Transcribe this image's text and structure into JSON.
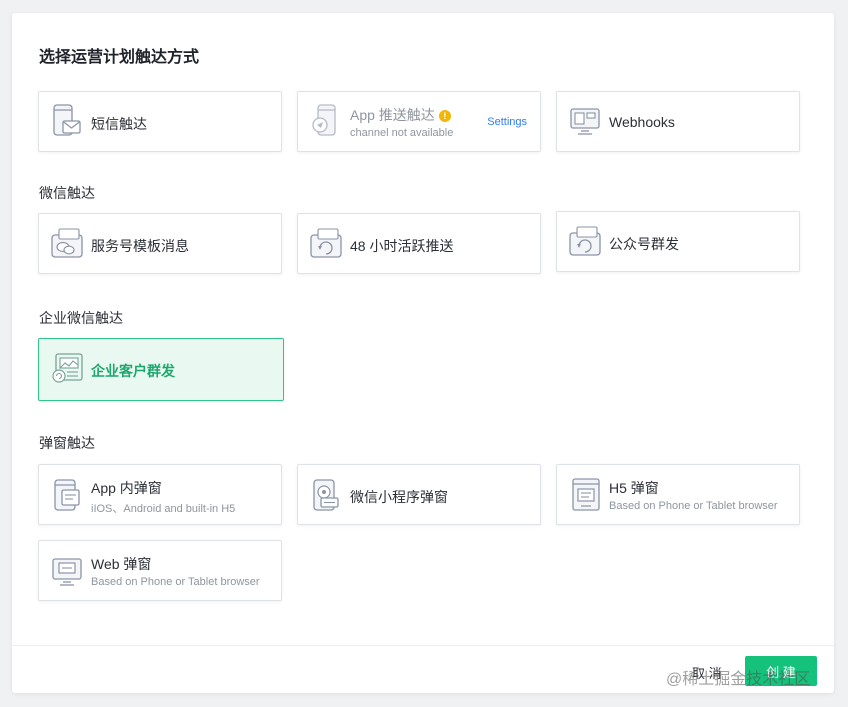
{
  "title": "选择运营计划触达方式",
  "sections": {
    "wechat": "微信触达",
    "wecom": "企业微信触达",
    "popup": "弹窗触达"
  },
  "cards": {
    "sms": {
      "label": "短信触达"
    },
    "app_push": {
      "label": "App 推送触达",
      "sub": "channel not available",
      "settings": "Settings",
      "warn": "!"
    },
    "webhooks": {
      "label": "Webhooks"
    },
    "service_template": {
      "label": "服务号模板消息"
    },
    "active_48h": {
      "label": "48 小时活跃推送"
    },
    "public_mass": {
      "label": "公众号群发"
    },
    "wecom_mass": {
      "label": "企业客户群发"
    },
    "app_popup": {
      "label": "App 内弹窗",
      "sub": "iIOS、Android and built-in H5"
    },
    "mini_popup": {
      "label": "微信小程序弹窗"
    },
    "h5_popup": {
      "label": "H5 弹窗",
      "sub": "Based on  Phone or Tablet browser"
    },
    "web_popup": {
      "label": "Web 弹窗",
      "sub": "Based on  Phone or Tablet browser"
    }
  },
  "footer": {
    "cancel": "取 消",
    "create": "创 建"
  },
  "watermark": "@稀土掘金技术社区",
  "colors": {
    "accent": "#15c27b",
    "selected_bg": "#e9f8f1",
    "link": "#2e7cf6",
    "warning": "#f2b705"
  },
  "selected_card": "wecom_mass"
}
